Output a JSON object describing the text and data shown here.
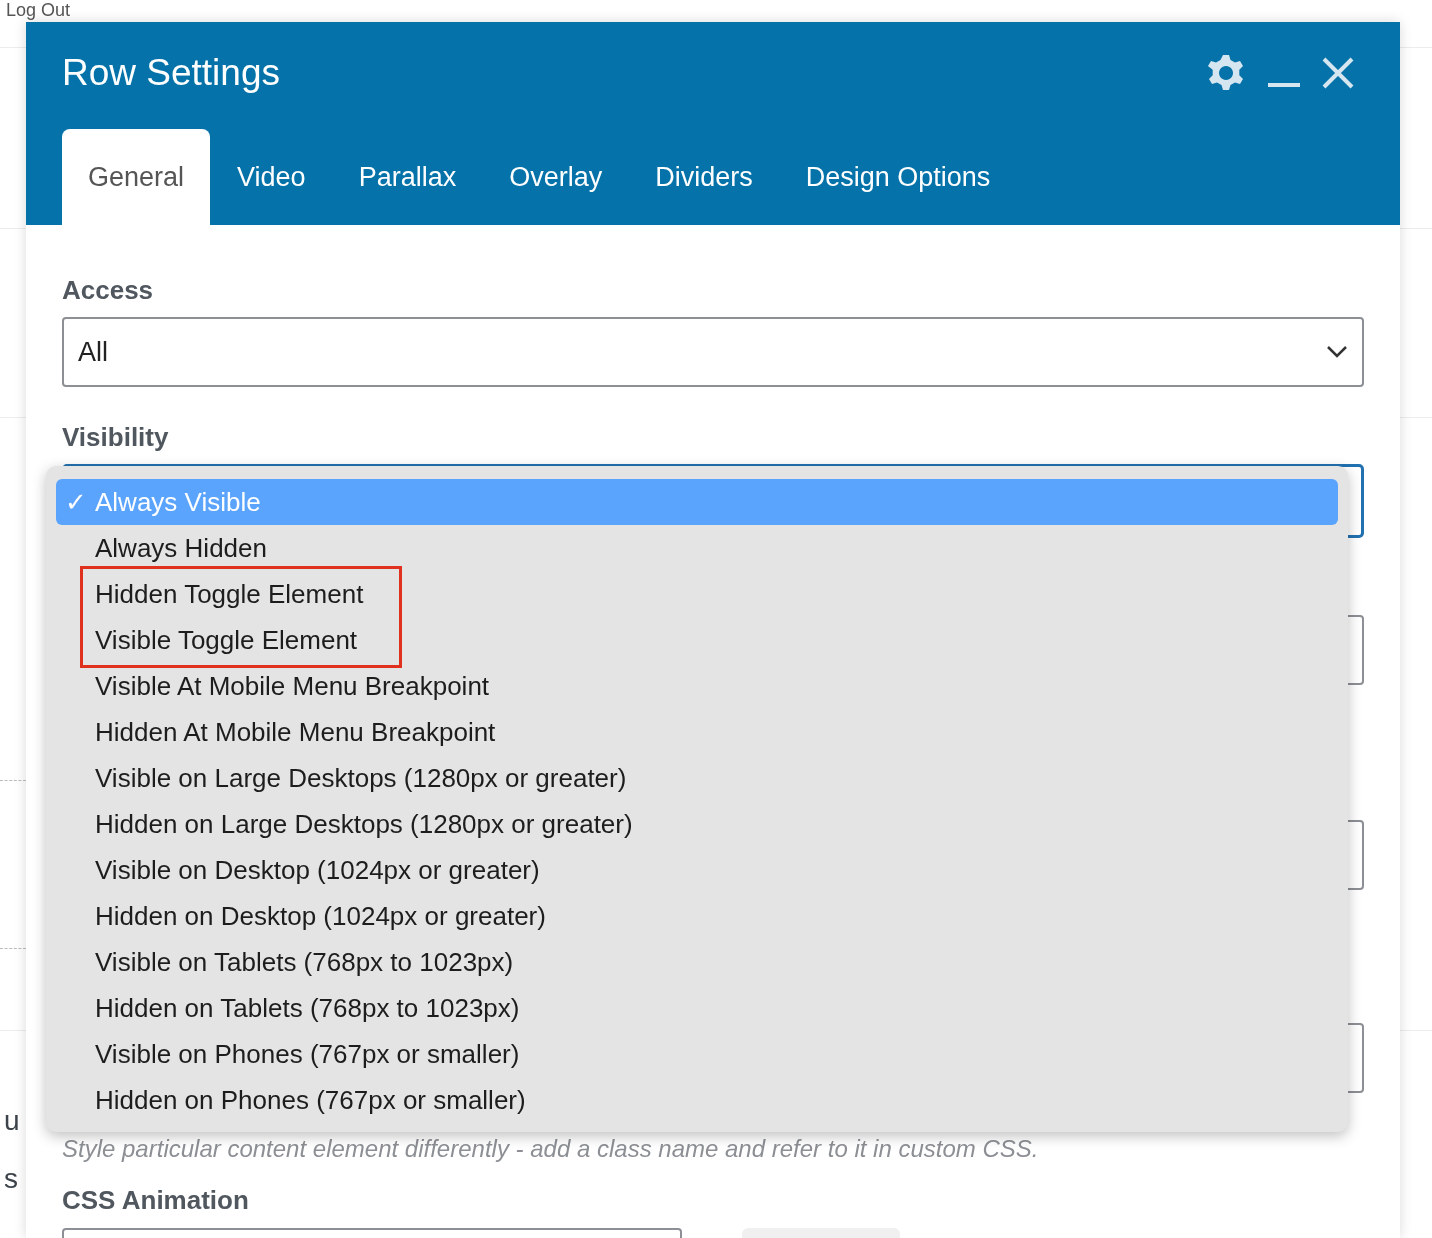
{
  "background_page": {
    "logout_link": "Log Out",
    "fragments": [
      "u",
      "s"
    ]
  },
  "window": {
    "title": "Row Settings"
  },
  "check_mark": "✓",
  "tabs": [
    {
      "label": "General",
      "selected": true
    },
    {
      "label": "Video",
      "selected": false
    },
    {
      "label": "Parallax",
      "selected": false
    },
    {
      "label": "Overlay",
      "selected": false
    },
    {
      "label": "Dividers",
      "selected": false
    },
    {
      "label": "Design Options",
      "selected": false
    }
  ],
  "access": {
    "label": "Access",
    "value": "All"
  },
  "visibility": {
    "label": "Visibility",
    "options": [
      {
        "label": "Always Visible",
        "selected": true,
        "annotated": false
      },
      {
        "label": "Always Hidden",
        "selected": false,
        "annotated": false
      },
      {
        "label": "Hidden Toggle Element",
        "selected": false,
        "annotated": true
      },
      {
        "label": "Visible Toggle Element",
        "selected": false,
        "annotated": true
      },
      {
        "label": "Visible At Mobile Menu Breakpoint",
        "selected": false,
        "annotated": false
      },
      {
        "label": "Hidden At Mobile Menu Breakpoint",
        "selected": false,
        "annotated": false
      },
      {
        "label": "Visible on Large Desktops (1280px or greater)",
        "selected": false,
        "annotated": false
      },
      {
        "label": "Hidden on Large Desktops (1280px or greater)",
        "selected": false,
        "annotated": false
      },
      {
        "label": "Visible on Desktop (1024px or greater)",
        "selected": false,
        "annotated": false
      },
      {
        "label": "Hidden on Desktop (1024px or greater)",
        "selected": false,
        "annotated": false
      },
      {
        "label": "Visible on Tablets (768px to 1023px)",
        "selected": false,
        "annotated": false
      },
      {
        "label": "Hidden on Tablets (768px to 1023px)",
        "selected": false,
        "annotated": false
      },
      {
        "label": "Visible on Phones (767px or smaller)",
        "selected": false,
        "annotated": false
      },
      {
        "label": "Hidden on Phones (767px or smaller)",
        "selected": false,
        "annotated": false
      }
    ]
  },
  "class_help": "Style particular content element differently - add a class name and refer to it in custom CSS.",
  "css_animation": {
    "label": "CSS Animation"
  }
}
